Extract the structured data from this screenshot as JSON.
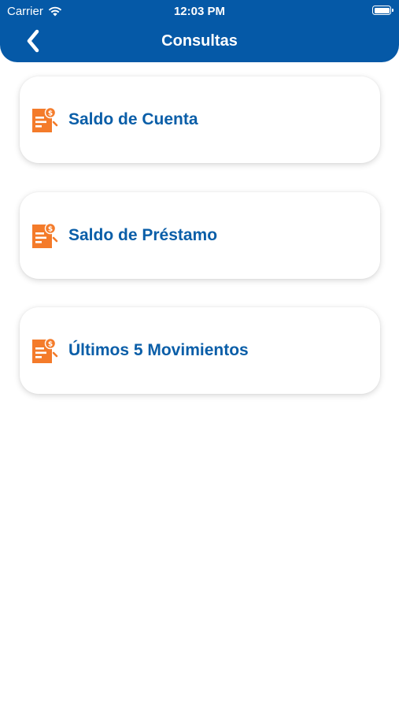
{
  "status_bar": {
    "carrier": "Carrier",
    "time": "12:03 PM",
    "wifi_icon": "wifi-icon",
    "battery_icon": "battery-icon"
  },
  "nav": {
    "title": "Consultas",
    "back_icon": "chevron-left-icon"
  },
  "colors": {
    "header_bg": "#0559a7",
    "label_text": "#0a5ea8",
    "icon_accent": "#f47b2a"
  },
  "menu": {
    "items": [
      {
        "label": "Saldo de Cuenta",
        "icon": "money-document-icon"
      },
      {
        "label": "Saldo de Préstamo",
        "icon": "money-document-icon"
      },
      {
        "label": "Últimos 5 Movimientos",
        "icon": "money-document-icon"
      }
    ]
  }
}
